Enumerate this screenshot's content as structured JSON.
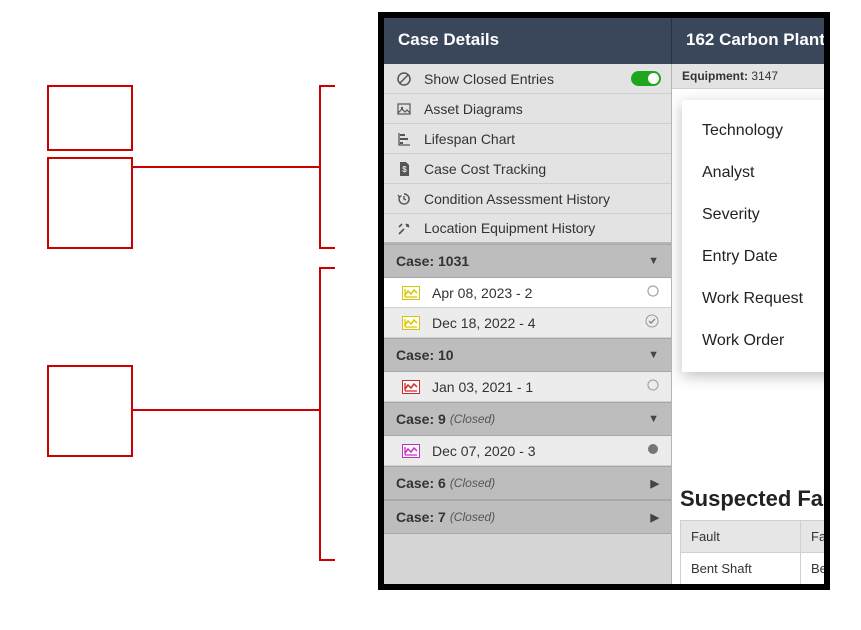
{
  "annotations": {
    "top_label": "",
    "bottom_label": ""
  },
  "header": {
    "left_title": "Case Details",
    "right_title": "162 Carbon Plant"
  },
  "equipment": {
    "label": "Equipment:",
    "value": "3147"
  },
  "options": [
    {
      "icon": "prohibit-icon",
      "label": "Show Closed Entries",
      "toggle": true
    },
    {
      "icon": "image-icon",
      "label": "Asset Diagrams"
    },
    {
      "icon": "gantt-icon",
      "label": "Lifespan Chart"
    },
    {
      "icon": "doc-dollar-icon",
      "label": "Case Cost Tracking"
    },
    {
      "icon": "history-icon",
      "label": "Condition Assessment History"
    },
    {
      "icon": "tools-icon",
      "label": "Location Equipment History"
    }
  ],
  "cases": [
    {
      "title": "Case: 1031",
      "closed": false,
      "expanded": true,
      "entries": [
        {
          "label": "Apr 08, 2023 - 2",
          "color": "#d6c800",
          "bg": "white",
          "status": "○"
        },
        {
          "label": "Dec 18, 2022 - 4",
          "color": "#d6c800",
          "bg": "light",
          "status": "✓"
        }
      ]
    },
    {
      "title": "Case: 10",
      "closed": false,
      "expanded": true,
      "entries": [
        {
          "label": "Jan 03, 2021 - 1",
          "color": "#cc2a2a",
          "bg": "light",
          "status": "○"
        }
      ]
    },
    {
      "title": "Case: 9",
      "closed": true,
      "expanded": true,
      "entries": [
        {
          "label": "Dec 07, 2020 - 3",
          "color": "#c030c0",
          "bg": "light",
          "status": "●"
        }
      ]
    },
    {
      "title": "Case: 6",
      "closed": true,
      "expanded": false,
      "entries": []
    },
    {
      "title": "Case: 7",
      "closed": true,
      "expanded": false,
      "entries": []
    }
  ],
  "closed_label": "(Closed)",
  "dropdown": {
    "items": [
      "Technology",
      "Analyst",
      "Severity",
      "Entry Date",
      "Work Request",
      "Work Order"
    ]
  },
  "suspected": {
    "title": "Suspected Faults",
    "columns": [
      "Fault",
      "Fault"
    ],
    "rows": [
      [
        "Bent Shaft",
        "Be"
      ]
    ]
  }
}
